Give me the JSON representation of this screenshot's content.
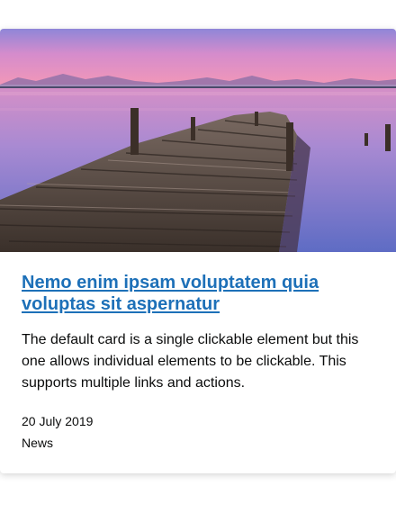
{
  "card": {
    "image_alt": "Wooden pier on a lake at sunset",
    "title": "Nemo enim ipsam voluptatem quia voluptas sit aspernatur",
    "description": "The default card is a single clickable element but this one allows individual elements to be clickable. This supports multiple links and actions.",
    "date": "20 July 2019",
    "category": "News"
  },
  "colors": {
    "link": "#1d70b8",
    "text": "#0b0c0c",
    "sky_top": "#9a8ad6",
    "sky_pink": "#e58ec0",
    "water": "#6f74c8"
  }
}
